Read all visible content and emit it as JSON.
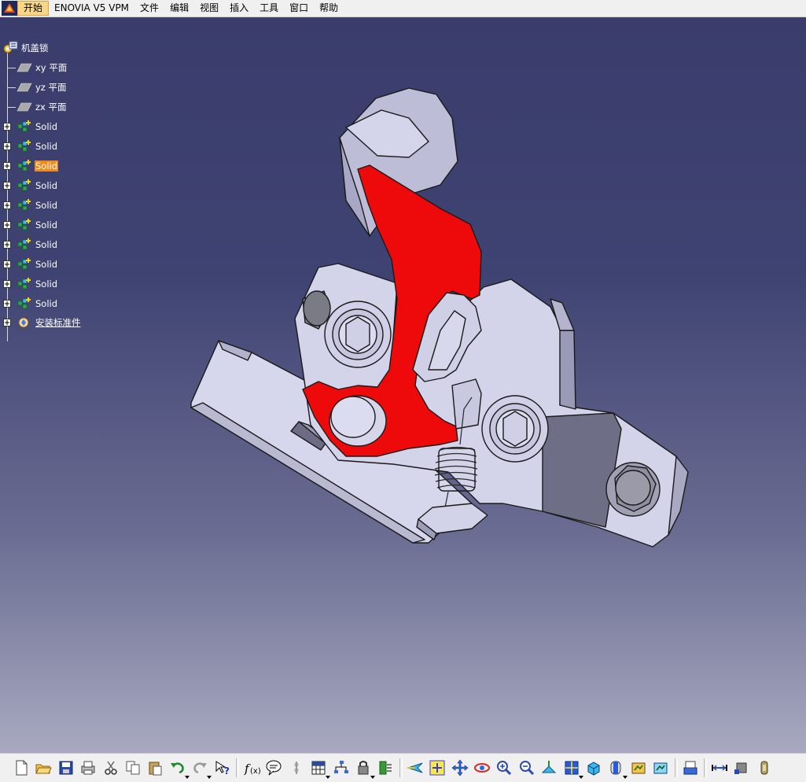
{
  "menubar": {
    "items": [
      "开始",
      "ENOVIA V5 VPM",
      "文件",
      "编辑",
      "视图",
      "插入",
      "工具",
      "窗口",
      "帮助"
    ]
  },
  "tree": {
    "root": "机盖锁",
    "planes": [
      "xy 平面",
      "yz 平面",
      "zx 平面"
    ],
    "solids": [
      "Solid",
      "Solid",
      "Solid",
      "Solid",
      "Solid",
      "Solid",
      "Solid",
      "Solid",
      "Solid",
      "Solid"
    ],
    "selected_solid_index": 2,
    "last": "安装标准件"
  },
  "colors": {
    "background_top": "#3a3d6c",
    "background_bottom": "#a8a9c0",
    "part_color": "#cfcfe8",
    "highlight_color": "#ee0a0a",
    "selection_color": "#f08a1c"
  },
  "toolbar": {
    "icons": [
      "new-icon",
      "open-icon",
      "save-icon",
      "print-icon",
      "cut-icon",
      "copy-icon",
      "paste-icon",
      "undo-icon",
      "redo-icon",
      "whats-this-icon",
      "formula-icon",
      "comment-icon",
      "link-icon",
      "table-icon",
      "tree-icon",
      "catalog-icon",
      "measure-icon",
      "fly-mode-icon",
      "fit-all-icon",
      "pan-icon",
      "rotate-icon",
      "zoom-in-icon",
      "zoom-out-icon",
      "normal-view-icon",
      "multi-view-icon",
      "iso-view-icon",
      "render-style-icon",
      "hide-show-icon",
      "swap-space-icon",
      "scan-icon",
      "measure-between-icon",
      "measure-item-icon",
      "inertia-icon"
    ]
  }
}
